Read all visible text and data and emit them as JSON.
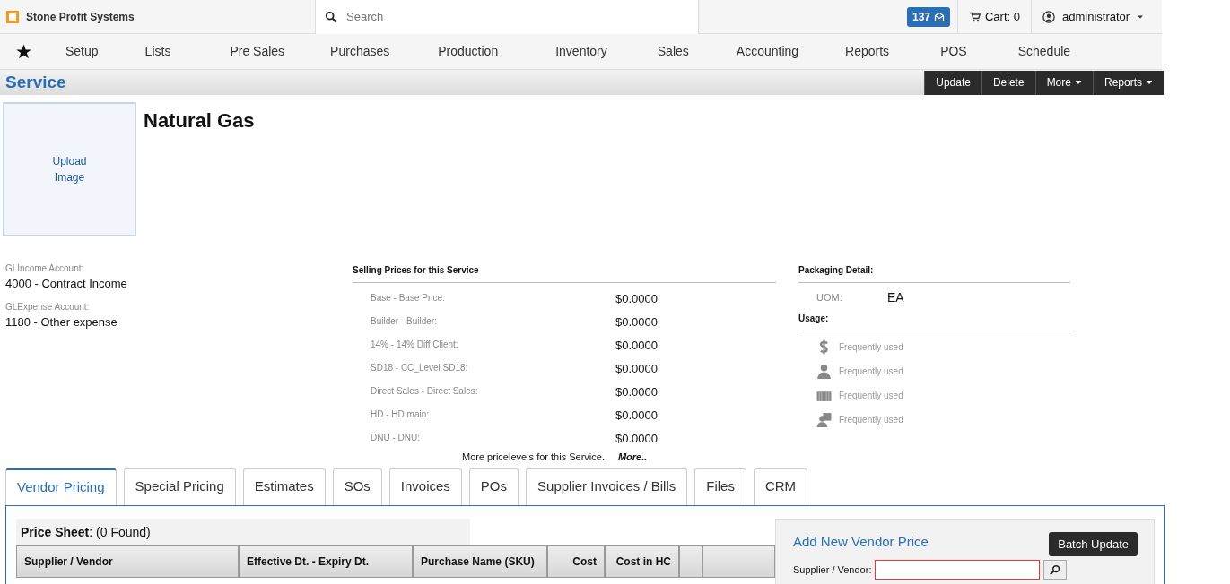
{
  "brand": "Stone Profit Systems",
  "search": {
    "placeholder": "Search"
  },
  "notifications": "137",
  "cart": "Cart: 0",
  "user": "administrator",
  "nav": [
    "Setup",
    "Lists",
    "Pre Sales",
    "Purchases",
    "Production",
    "Inventory",
    "Sales",
    "Accounting",
    "Reports",
    "POS",
    "Schedule"
  ],
  "page_title": "Service",
  "actions": [
    {
      "label": "Update",
      "dropdown": false
    },
    {
      "label": "Delete",
      "dropdown": false
    },
    {
      "label": "More",
      "dropdown": true
    },
    {
      "label": "Reports",
      "dropdown": true
    }
  ],
  "upload": "Upload Image",
  "item_name": "Natural Gas",
  "accounts": [
    {
      "label": "GLIncome Account:",
      "value": "4000 - Contract Income"
    },
    {
      "label": "GLExpense Account:",
      "value": "1180 - Other expense"
    }
  ],
  "selling_prices": {
    "title": "Selling Prices for this Service",
    "rows": [
      {
        "label": "Base - Base Price:",
        "price": "$0.0000"
      },
      {
        "label": "Builder - Builder:",
        "price": "$0.0000"
      },
      {
        "label": "14% - 14% Diff Client:",
        "price": "$0.0000"
      },
      {
        "label": "SD18 - CC_Level SD18:",
        "price": "$0.0000"
      },
      {
        "label": "Direct Sales - Direct Sales:",
        "price": "$0.0000"
      },
      {
        "label": "HD - HD main:",
        "price": "$0.0000"
      },
      {
        "label": "DNU - DNU:",
        "price": "$0.0000"
      }
    ],
    "more_text": "More pricelevels for this Service.",
    "more_link": "More.."
  },
  "packaging": {
    "title": "Packaging Detail:",
    "uom_label": "UOM:",
    "uom_value": "EA",
    "usage_title": "Usage:",
    "usage": [
      {
        "kind": "dollar",
        "text": "Frequently used"
      },
      {
        "kind": "person",
        "text": "Frequently used"
      },
      {
        "kind": "container",
        "text": "Frequently used"
      },
      {
        "kind": "people",
        "text": "Frequently used"
      }
    ]
  },
  "tabs": [
    {
      "label": "Vendor Pricing",
      "selected": true
    },
    {
      "label": "Special Pricing",
      "selected": false
    },
    {
      "label": "Estimates",
      "selected": false
    },
    {
      "label": "SOs",
      "selected": false
    },
    {
      "label": "Invoices",
      "selected": false
    },
    {
      "label": "POs",
      "selected": false
    },
    {
      "label": "Supplier Invoices / Bills",
      "selected": false
    },
    {
      "label": "Files",
      "selected": false
    },
    {
      "label": "CRM",
      "selected": false
    }
  ],
  "price_sheet": {
    "title": "**Price Sheet**: (0 Found)",
    "columns": [
      "Supplier / Vendor",
      "Effective Dt. - Expiry Dt.",
      "Purchase Name (SKU)",
      "Cost",
      "Cost in HC"
    ]
  },
  "add_panel": {
    "title": "Add New Vendor Price",
    "button": "Batch Update",
    "supplier_label": "Supplier / Vendor:"
  }
}
